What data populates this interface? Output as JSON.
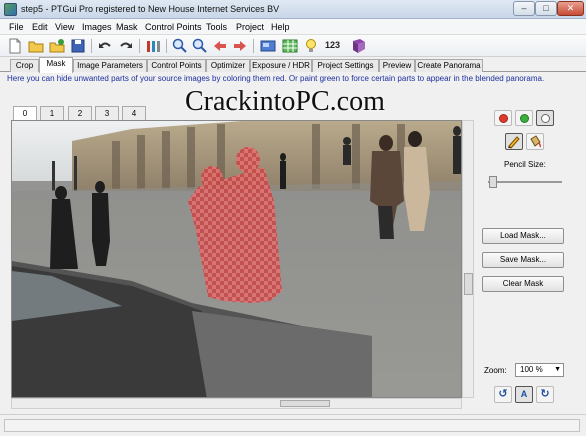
{
  "window": {
    "title": "step5 - PTGui Pro registered to New House Internet Services BV",
    "min_glyph": "–",
    "max_glyph": "□",
    "close_glyph": "✕"
  },
  "menu": [
    "File",
    "Edit",
    "View",
    "Images",
    "Mask",
    "Control Points",
    "Tools",
    "Project",
    "Help"
  ],
  "toolbar": {
    "counter_label": "123"
  },
  "tabs": [
    "Crop",
    "Mask",
    "Image Parameters",
    "Control Points",
    "Optimizer",
    "Exposure / HDR",
    "Project Settings",
    "Preview",
    "Create Panorama"
  ],
  "active_tab": "Mask",
  "hint": "Here you can hide unwanted parts of your source images by coloring them red. Or paint green to force certain parts to appear in the blended panorama.",
  "image_tabs": [
    "0",
    "1",
    "2",
    "3",
    "4"
  ],
  "active_image_tab": "0",
  "watermark": "CrackintoPC.com",
  "mask_panel": {
    "colors": {
      "red": "#e03a2c",
      "green": "#3cae3c",
      "clear": "#ffffff"
    },
    "pencil_size_label": "Pencil Size:",
    "pencil_size": 0.03,
    "load_mask": "Load Mask...",
    "save_mask": "Save Mask...",
    "clear_mask": "Clear Mask",
    "zoom_label": "Zoom:",
    "zoom_value": "100 %",
    "auto_label": "A"
  }
}
